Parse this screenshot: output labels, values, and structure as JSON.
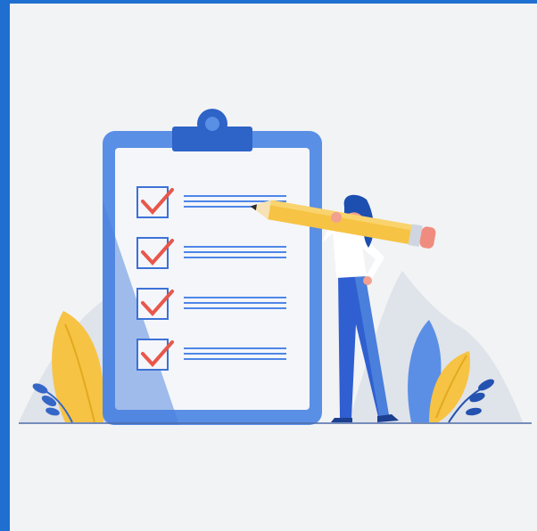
{
  "scene": {
    "colors": {
      "border": "#1f6fd1",
      "background": "#f2f3f5",
      "clipboard_frame": "#5a8fe6",
      "clipboard_paper": "#f4f6fa",
      "clip": "#2e63c7",
      "checkbox_stroke": "#3d72d6",
      "check_mark": "#e8574c",
      "line_blue": "#4f86e8",
      "pencil_body": "#f6c344",
      "pencil_eraser": "#f08c7f",
      "skin": "#f2a08f",
      "hair": "#1c4fb0",
      "shirt": "#ffffff",
      "pants": "#2f5fd0",
      "leaf_yellow": "#f6c344",
      "leaf_blue": "#5b8fe6",
      "hill": "#dfe3ea",
      "ground": "#4a6ba8"
    },
    "checklist": {
      "rows": [
        {
          "checked": true
        },
        {
          "checked": true
        },
        {
          "checked": true
        },
        {
          "checked": true
        }
      ]
    }
  }
}
